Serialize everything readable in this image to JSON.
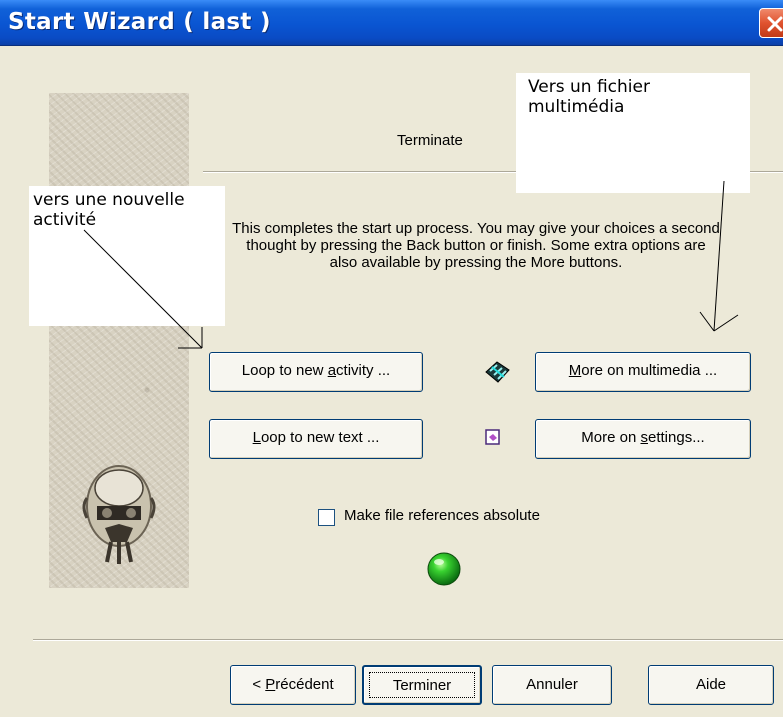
{
  "window": {
    "title": "Start Wizard ( last )",
    "close_icon": "close-icon",
    "accent": "#0a55d2"
  },
  "page": {
    "heading": "Terminate",
    "description": "This completes the start up process. You may give your choices a second thought by pressing the Back button or finish. Some extra options are also available by pressing the More buttons."
  },
  "annotations": {
    "left_note": "vers une nouvelle activité",
    "right_note": "Vers un fichier multimédia"
  },
  "options": {
    "loop_activity": {
      "before": "Loop to new ",
      "accel": "a",
      "after": "ctivity ..."
    },
    "loop_text": {
      "before": "",
      "accel": "L",
      "after": "oop to new text ..."
    },
    "more_multimedia": {
      "before": "",
      "accel": "M",
      "after": "ore on multimedia ..."
    },
    "more_settings": {
      "before": "More on ",
      "accel": "s",
      "after": "ettings..."
    },
    "multimedia_icon": "multimedia-icon",
    "settings_icon": "settings-icon"
  },
  "checkbox": {
    "label": "Make file references absolute",
    "checked": false
  },
  "status_icon": "green-globe-icon",
  "footer": {
    "prev": {
      "before": "< ",
      "accel": "P",
      "after": "récédent"
    },
    "finish": "Terminer",
    "cancel": "Annuler",
    "help": "Aide"
  }
}
